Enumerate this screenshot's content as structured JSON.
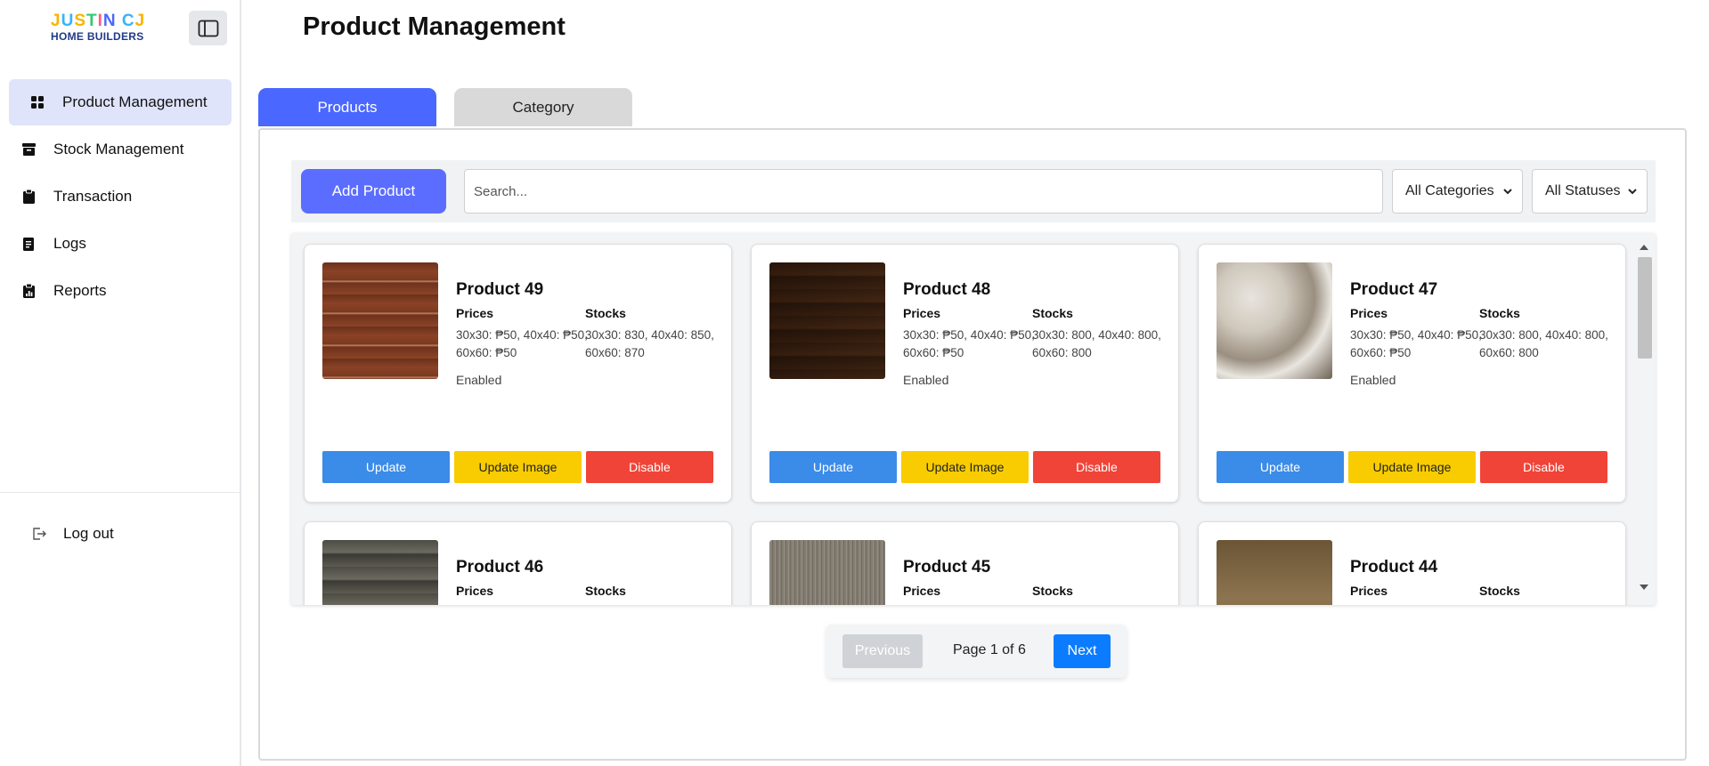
{
  "sidebar": {
    "logo_line1": "JUSTIN CJ",
    "logo_line2": "HOME BUILDERS",
    "items": [
      {
        "label": "Product Management",
        "icon": "grid-icon"
      },
      {
        "label": "Stock Management",
        "icon": "archive-box-icon"
      },
      {
        "label": "Transaction",
        "icon": "clipboard-icon"
      },
      {
        "label": "Logs",
        "icon": "document-icon"
      },
      {
        "label": "Reports",
        "icon": "report-icon"
      }
    ],
    "logout_label": "Log out"
  },
  "header": {
    "title": "Product Management"
  },
  "tabs": {
    "products": "Products",
    "category": "Category"
  },
  "toolbar": {
    "add_label": "Add Product",
    "search_placeholder": "Search...",
    "category_select": "All Categories",
    "status_select": "All Statuses"
  },
  "labels": {
    "prices": "Prices",
    "stocks": "Stocks",
    "update": "Update",
    "update_image": "Update Image",
    "disable": "Disable"
  },
  "products": [
    {
      "name": "Product 49",
      "prices": "30x30: ₱50, 40x40: ₱50, 60x60: ₱50",
      "stocks": "30x30: 830, 40x40: 850, 60x60: 870",
      "status": "Enabled"
    },
    {
      "name": "Product 48",
      "prices": "30x30: ₱50, 40x40: ₱50, 60x60: ₱50",
      "stocks": "30x30: 800, 40x40: 800, 60x60: 800",
      "status": "Enabled"
    },
    {
      "name": "Product 47",
      "prices": "30x30: ₱50, 40x40: ₱50, 60x60: ₱50",
      "stocks": "30x30: 800, 40x40: 800, 60x60: 800",
      "status": "Enabled"
    },
    {
      "name": "Product 46",
      "prices": "",
      "stocks": "",
      "status": ""
    },
    {
      "name": "Product 45",
      "prices": "",
      "stocks": "",
      "status": ""
    },
    {
      "name": "Product 44",
      "prices": "",
      "stocks": "",
      "status": ""
    }
  ],
  "pagination": {
    "previous": "Previous",
    "page_info": "Page 1 of 6",
    "next": "Next"
  },
  "colors": {
    "accent": "#4a67ff",
    "update": "#3b8be8",
    "update_image": "#f8cc00",
    "disable": "#f04438",
    "next": "#0b7cff"
  }
}
